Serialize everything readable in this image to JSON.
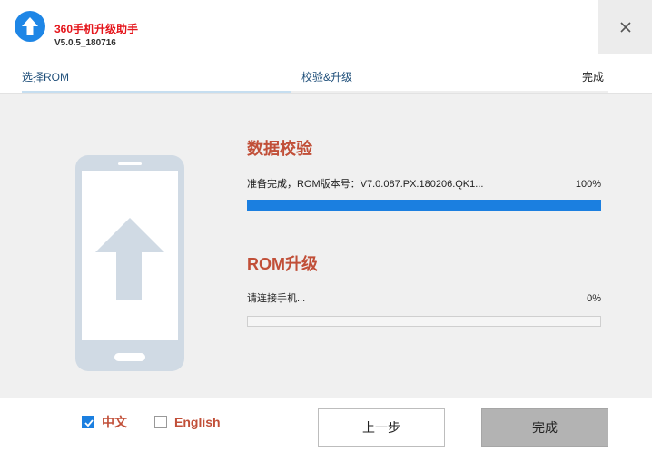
{
  "app": {
    "title": "360手机升级助手",
    "version": "V5.0.5_180716"
  },
  "steps": [
    {
      "label": "选择ROM"
    },
    {
      "label": "校验&升级"
    },
    {
      "label": "完成"
    }
  ],
  "step_progress": 0.46,
  "verify": {
    "title": "数据校验",
    "status": "准备完成，ROM版本号：V7.0.087.PX.180206.QK1...",
    "percent_label": "100%",
    "progress": 1.0
  },
  "upgrade": {
    "title": "ROM升级",
    "status": "请连接手机...",
    "percent_label": "0%",
    "progress": 0.0
  },
  "language": {
    "chinese_label": "中文",
    "chinese_checked": true,
    "english_label": "English",
    "english_checked": false
  },
  "buttons": {
    "back_label": "上一步",
    "done_label": "完成"
  },
  "icons": {
    "app_logo": "upload-arrow-icon",
    "close": "close-icon",
    "phone": "phone-upload-icon",
    "checkbox_checked": "check-icon"
  },
  "colors": {
    "accent": "#1b7fe0",
    "title_red": "#e5151b",
    "section_title": "#c14f38",
    "phone_illustration": "#d0dae4"
  }
}
